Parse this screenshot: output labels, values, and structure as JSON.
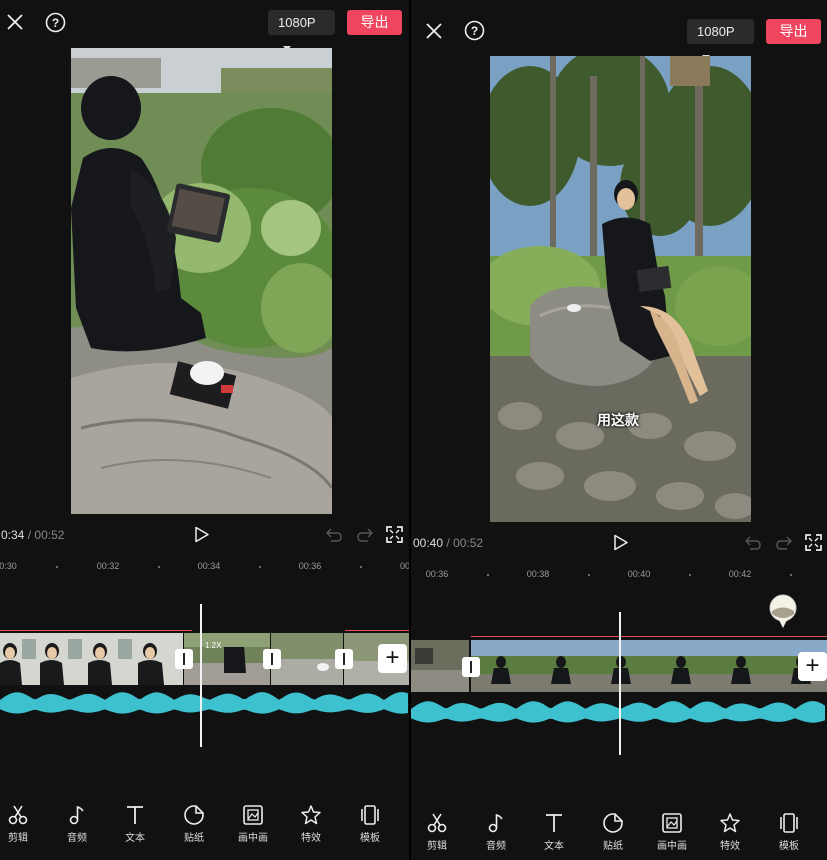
{
  "panels": [
    {
      "resolution": "1080P",
      "export_label": "导出",
      "time_current": "0:34",
      "time_separator": "/",
      "time_total": "00:52",
      "ruler_ticks": [
        "0:30",
        "00:32",
        "00:34",
        "00:36",
        "00"
      ],
      "speed_label": "1.2X",
      "subtitle": ""
    },
    {
      "resolution": "1080P",
      "export_label": "导出",
      "time_current": "00:40",
      "time_separator": "/",
      "time_total": "00:52",
      "ruler_ticks": [
        "00:36",
        "00:38",
        "00:40",
        "00:42"
      ],
      "speed_label": "",
      "subtitle": "用这款"
    }
  ],
  "toolbar": [
    {
      "label": "剪辑",
      "icon": "scissors-icon"
    },
    {
      "label": "音频",
      "icon": "music-note-icon"
    },
    {
      "label": "文本",
      "icon": "text-t-icon"
    },
    {
      "label": "贴纸",
      "icon": "sticker-icon"
    },
    {
      "label": "画中画",
      "icon": "picture-in-picture-icon"
    },
    {
      "label": "特效",
      "icon": "star-effects-icon"
    },
    {
      "label": "模板",
      "icon": "template-icon"
    }
  ],
  "colors": {
    "background": "#111111",
    "export": "#f0455f",
    "audio_wave": "#3ec1cf",
    "playhead": "#f2f2f2",
    "cut_line": "#e8504f"
  }
}
